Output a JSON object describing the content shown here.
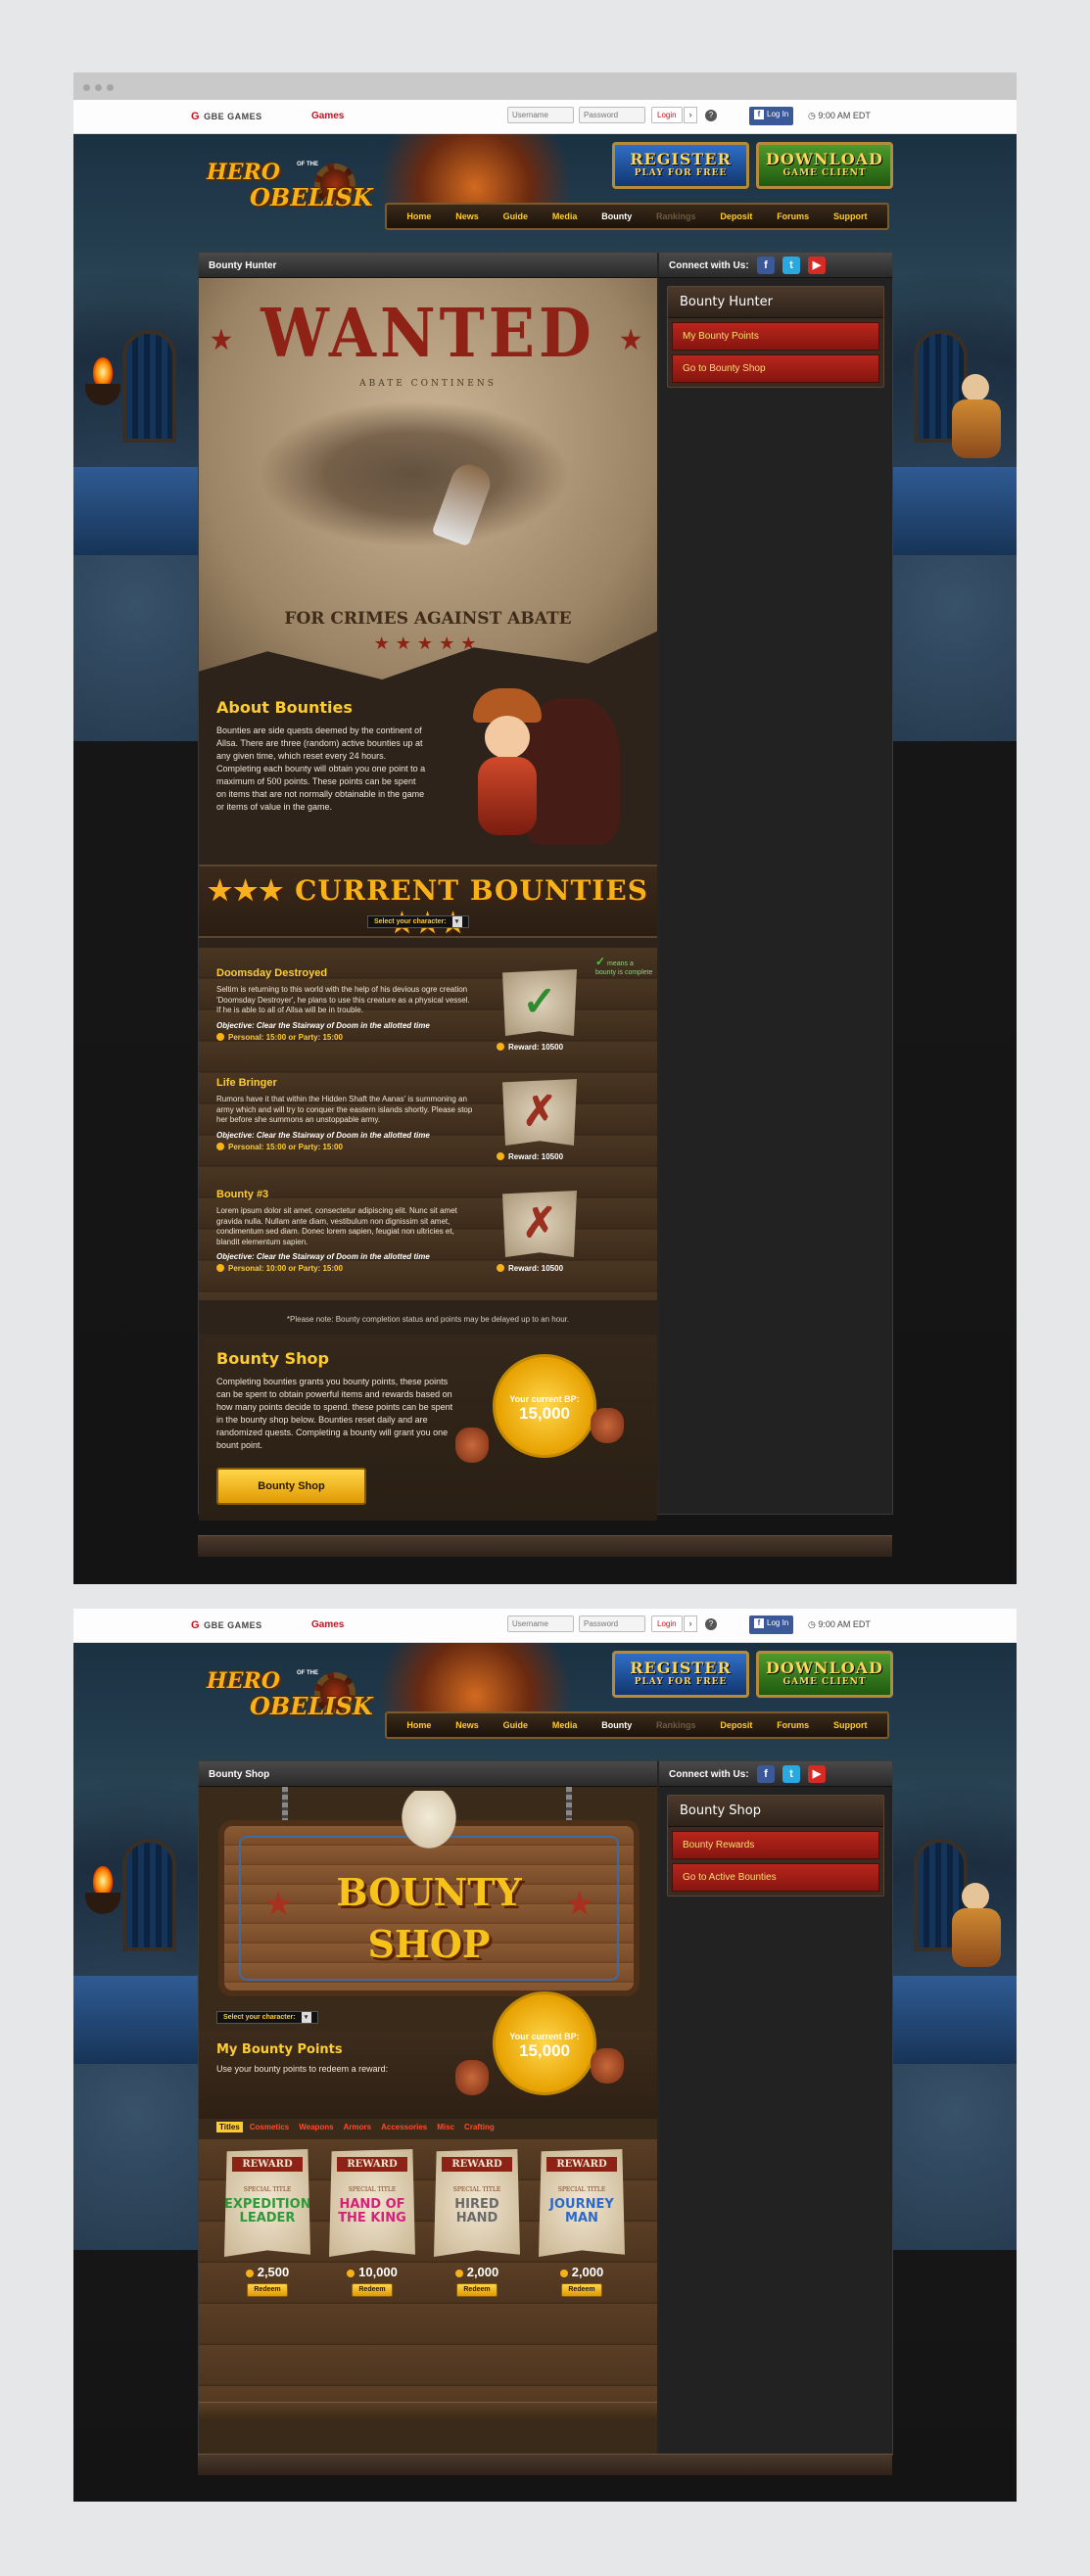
{
  "topbar": {
    "brand": "GBE GAMES",
    "brand_mark": "G",
    "games_link": "Games",
    "username_placeholder": "Username",
    "password_placeholder": "Password",
    "login": "Login",
    "login_arrow": "›",
    "help": "?",
    "fb_login": "Log In",
    "fb_mark": "f",
    "time": "9:00 AM EDT"
  },
  "header": {
    "logo_line1": "HERO",
    "logo_of_the": "OF THE",
    "logo_line2": "OBELISK",
    "register_line1": "REGISTER",
    "register_line2": "PLAY FOR FREE",
    "download_line1": "DOWNLOAD",
    "download_line2": "GAME CLIENT"
  },
  "nav": [
    "Home",
    "News",
    "Guide",
    "Media",
    "Bounty",
    "Rankings",
    "Deposit",
    "Forums",
    "Support"
  ],
  "sidebar": {
    "connect_label": "Connect with Us:",
    "social_icons": [
      "facebook-icon",
      "twitter-icon",
      "youtube-icon"
    ]
  },
  "page1": {
    "strip_title": "Bounty Hunter",
    "side_box_title": "Bounty Hunter",
    "side_links": [
      "My Bounty Points",
      "Go to Bounty Shop"
    ],
    "poster": {
      "wanted": "WANTED",
      "subtitle": "ABATE CONTINENS",
      "crimes": "FOR CRIMES AGAINST ABATE",
      "stars": "★★★★★",
      "wanted_stars_left": "★",
      "wanted_stars_right": "★"
    },
    "about": {
      "title": "About Bounties",
      "text": "Bounties are side quests deemed by the continent of Allsa. There are three (random) active bounties up at any given time, which reset every 24 hours. Completing each bounty will obtain you one point to a maximum of 500 points. These points can be spent on items that are not normally obtainable in the game or items of value in the game."
    },
    "current_bounties": "★★★  CURRENT BOUNTIES  ★★★",
    "select_character": "Select your character:",
    "select_arrow": "▾",
    "legend_note": "means a bounty is complete",
    "legend_check": "✓",
    "bounties": [
      {
        "title": "Doomsday Destroyed",
        "text": "Seltim is returning to this world with the help of his devious ogre creation 'Doomsday Destroyer', he plans to use this creature as a physical vessel. If he is able to all of Allsa will be in trouble.",
        "objective": "Objective: Clear the Stairway of Doom in the allotted time",
        "times": "Personal: 15:00 or Party: 15:00",
        "reward": "Reward: 10500",
        "mark": "✓",
        "complete": true
      },
      {
        "title": "Life Bringer",
        "text": "Rumors have it that within the Hidden Shaft the Aanas' is summoning an army which and will try to conquer the eastern islands shortly. Please stop her before she summons an unstoppable army.",
        "objective": "Objective: Clear the Stairway of Doom in the allotted time",
        "times": "Personal: 15:00 or Party: 15:00",
        "reward": "Reward: 10500",
        "mark": "✗",
        "complete": false
      },
      {
        "title": "Bounty #3",
        "text": "Lorem ipsum dolor sit amet, consectetur adipiscing elit. Nunc sit amet gravida nulla. Nullam ante diam, vestibulum non dignissim sit amet, condimentum sed diam. Donec lorem sapien, feugiat non ultricies et, blandit elementum sapien.",
        "objective": "Objective: Clear the Stairway of Doom in the allotted time",
        "times": "Personal: 10:00 or Party: 15:00",
        "reward": "Reward: 10500",
        "mark": "✗",
        "complete": false
      }
    ],
    "note": "*Please note: Bounty completion status and points may be delayed up to an hour.",
    "shop": {
      "title": "Bounty Shop",
      "text": "Completing bounties grants you bounty points, these points can be spent to obtain powerful items and rewards based on how many points decide to spend. these points can be spent in the bounty shop below. Bounties reset daily and are randomized quests. Completing a bounty will grant you one bount point.",
      "button": "Bounty Shop",
      "bp_label": "Your current BP:",
      "bp_value": "15,000"
    }
  },
  "page2": {
    "strip_title": "Bounty Shop",
    "side_box_title": "Bounty Shop",
    "side_links": [
      "Bounty Rewards",
      "Go to Active Bounties"
    ],
    "sign_line1": "BOUNTY",
    "sign_line2": "SHOP",
    "select_character": "Select your character:",
    "select_arrow": "▾",
    "points_title": "My Bounty Points",
    "points_text": "Use your bounty points to redeem a reward:",
    "bp_label": "Your current BP:",
    "bp_value": "15,000",
    "tabs": [
      "Titles",
      "Cosmetics",
      "Weapons",
      "Armors",
      "Accessories",
      "Misc",
      "Crafting"
    ],
    "active_tab": "Titles",
    "rewards": [
      {
        "header": "REWARD",
        "special": "SPECIAL TITLE",
        "name": "EXPEDITION LEADER",
        "color": "#2e9a3a",
        "cost": "2,500",
        "redeem": "Redeem"
      },
      {
        "header": "REWARD",
        "special": "SPECIAL TITLE",
        "name": "HAND OF THE KING",
        "color": "#d4227a",
        "cost": "10,000",
        "redeem": "Redeem"
      },
      {
        "header": "REWARD",
        "special": "SPECIAL TITLE",
        "name": "HIRED HAND",
        "color": "#6a6a6a",
        "cost": "2,000",
        "redeem": "Redeem"
      },
      {
        "header": "REWARD",
        "special": "SPECIAL TITLE",
        "name": "JOURNEY MAN",
        "color": "#2a6ac8",
        "cost": "2,000",
        "redeem": "Redeem"
      }
    ]
  }
}
